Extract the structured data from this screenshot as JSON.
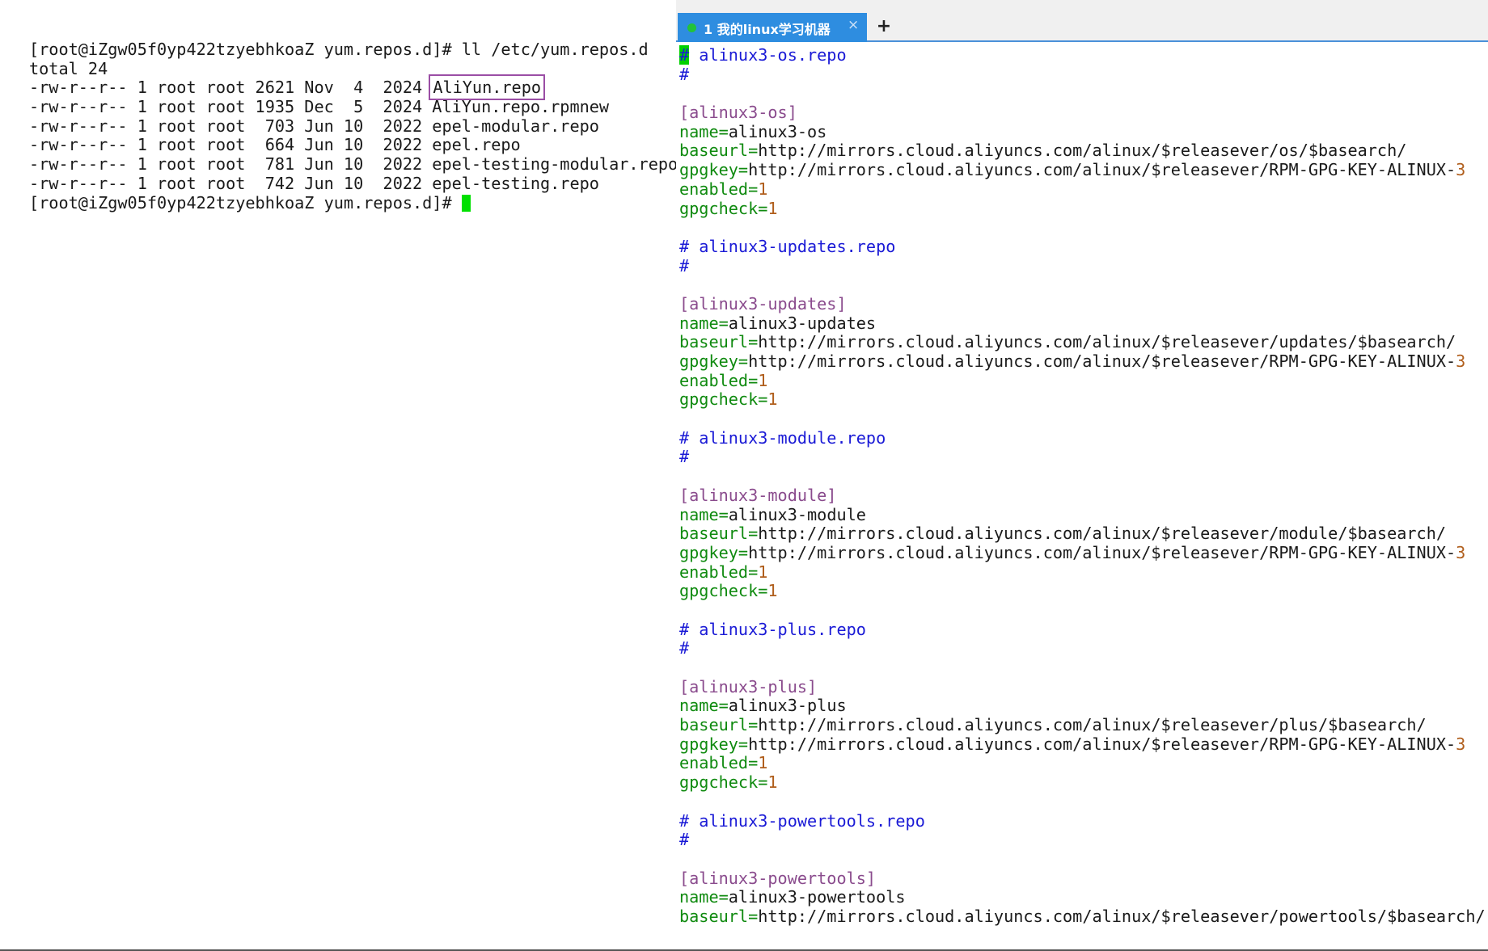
{
  "left_terminal": {
    "lines": [
      "[root@iZgw05f0yp422tzyebhkoaZ yum.repos.d]# ll /etc/yum.repos.d",
      "total 24",
      "-rw-r--r-- 1 root root 2621 Nov  4  2024 ",
      "-rw-r--r-- 1 root root 1935 Dec  5  2024 AliYun.repo.rpmnew",
      "-rw-r--r-- 1 root root  703 Jun 10  2022 epel-modular.repo",
      "-rw-r--r-- 1 root root  664 Jun 10  2022 epel.repo",
      "-rw-r--r-- 1 root root  781 Jun 10  2022 epel-testing-modular.repo",
      "-rw-r--r-- 1 root root  742 Jun 10  2022 epel-testing.repo",
      "[root@iZgw05f0yp422tzyebhkoaZ yum.repos.d]# "
    ],
    "highlighted_file": "AliYun.repo",
    "highlight_color": "#9b4ea5",
    "cursor_color": "#00e000"
  },
  "tabs": {
    "active_label": "1 我的linux学习机器",
    "close_glyph": "×",
    "add_glyph": "+",
    "status_dot_color": "#22c33a",
    "active_color": "#2e8de0"
  },
  "editor": {
    "blocks": [
      {
        "comment_name": " alinux3-os.repo",
        "section": "[alinux3-os]",
        "name": "alinux3-os",
        "baseurl": "http://mirrors.cloud.aliyuncs.com/alinux/$releasever/os/$basearch/",
        "gpgkey": "http://mirrors.cloud.aliyuncs.com/alinux/$releasever/RPM-GPG-KEY-ALINUX-",
        "gpgkey_suffix": "3",
        "enabled": "1",
        "gpgcheck": "1"
      },
      {
        "comment_name": " alinux3-updates.repo",
        "section": "[alinux3-updates]",
        "name": "alinux3-updates",
        "baseurl": "http://mirrors.cloud.aliyuncs.com/alinux/$releasever/updates/$basearch/",
        "gpgkey": "http://mirrors.cloud.aliyuncs.com/alinux/$releasever/RPM-GPG-KEY-ALINUX-",
        "gpgkey_suffix": "3",
        "enabled": "1",
        "gpgcheck": "1"
      },
      {
        "comment_name": " alinux3-module.repo",
        "section": "[alinux3-module]",
        "name": "alinux3-module",
        "baseurl": "http://mirrors.cloud.aliyuncs.com/alinux/$releasever/module/$basearch/",
        "gpgkey": "http://mirrors.cloud.aliyuncs.com/alinux/$releasever/RPM-GPG-KEY-ALINUX-",
        "gpgkey_suffix": "3",
        "enabled": "1",
        "gpgcheck": "1"
      },
      {
        "comment_name": " alinux3-plus.repo",
        "section": "[alinux3-plus]",
        "name": "alinux3-plus",
        "baseurl": "http://mirrors.cloud.aliyuncs.com/alinux/$releasever/plus/$basearch/",
        "gpgkey": "http://mirrors.cloud.aliyuncs.com/alinux/$releasever/RPM-GPG-KEY-ALINUX-",
        "gpgkey_suffix": "3",
        "enabled": "1",
        "gpgcheck": "1"
      },
      {
        "comment_name": " alinux3-powertools.repo",
        "section": "[alinux3-powertools]",
        "name": "alinux3-powertools",
        "baseurl": "http://mirrors.cloud.aliyuncs.com/alinux/$releasever/powertools/$basearch/"
      }
    ],
    "hash": "#",
    "key_name": "name=",
    "key_baseurl": "baseurl=",
    "key_gpgkey": "gpgkey=",
    "key_enabled": "enabled=",
    "key_gpgcheck": "gpgcheck="
  }
}
